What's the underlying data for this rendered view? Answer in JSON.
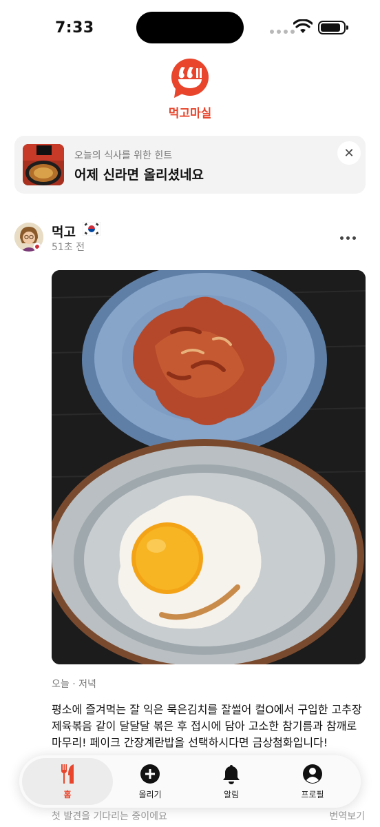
{
  "status_bar": {
    "time": "7:33"
  },
  "app": {
    "name": "먹고마실",
    "brand_color": "#e8452c"
  },
  "hint": {
    "subtitle": "오늘의 식사를 위한 힌트",
    "title": "어제 신라면 올리셨네요",
    "close_glyph": "✕"
  },
  "post": {
    "username": "먹고",
    "flag_icon": "korea-flag-icon",
    "time": "51초 전",
    "meal_tag": "오늘 · 저녁",
    "caption": "평소에 즐겨먹는 잘 익은 묵은김치를 잘썰어 컬O에서 구입한 고추장제육볶음 같이 달달달 볶은 후 접시에 담아 고소한 참기름과 참깨로 마무리! 페이크 간장계란밥을 선택하시다면 금상첨화입니다!",
    "footer": "첫 발견을 기다리는 중이에요",
    "translate": "번역보기"
  },
  "tabs": [
    {
      "label": "홈",
      "icon": "fork-knife-icon",
      "active": true
    },
    {
      "label": "올리기",
      "icon": "plus-circle-icon",
      "active": false
    },
    {
      "label": "알림",
      "icon": "bell-icon",
      "active": false
    },
    {
      "label": "프로필",
      "icon": "person-circle-icon",
      "active": false
    }
  ]
}
